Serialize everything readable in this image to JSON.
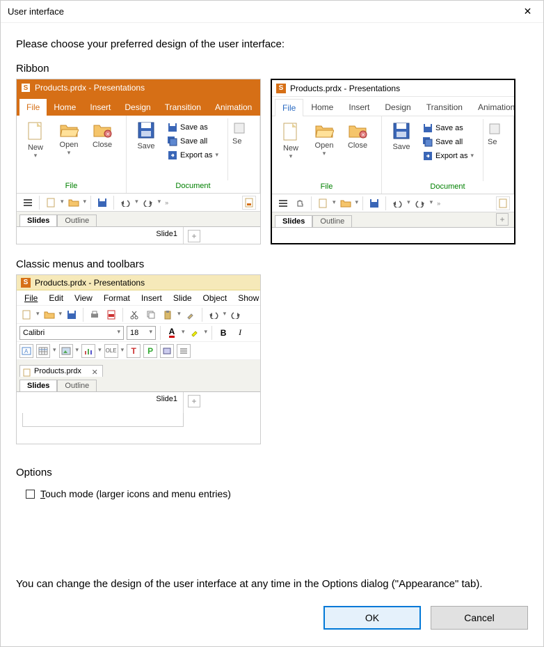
{
  "window": {
    "title": "User interface",
    "close_icon": "✕"
  },
  "intro": "Please choose your preferred design of the user interface:",
  "section_ribbon_label": "Ribbon",
  "section_classic_label": "Classic menus and toolbars",
  "ribbon_preview": {
    "titlebar": "Products.prdx - Presentations",
    "tabs": [
      "File",
      "Home",
      "Insert",
      "Design",
      "Transition",
      "Animation"
    ],
    "file_group": {
      "items": [
        "New",
        "Open",
        "Close"
      ],
      "label": "File"
    },
    "doc_group": {
      "save": "Save",
      "save_as": "Save as",
      "save_all": "Save all",
      "export_as": "Export as",
      "label": "Document",
      "se": "Se"
    },
    "slide_tabs": [
      "Slides",
      "Outline"
    ],
    "slide_name": "Slide1"
  },
  "classic_preview": {
    "titlebar": "Products.prdx - Presentations",
    "menus": [
      "File",
      "Edit",
      "View",
      "Format",
      "Insert",
      "Slide",
      "Object",
      "Show"
    ],
    "font_name": "Calibri",
    "font_size": "18",
    "doc_tab": "Products.prdx",
    "slide_tabs": [
      "Slides",
      "Outline"
    ],
    "slide_name": "Slide1"
  },
  "options": {
    "label": "Options",
    "touch_mode": "Touch mode (larger icons and menu entries)"
  },
  "footer": "You can change the design of the user interface at any time in the Options dialog (\"Appearance\" tab).",
  "buttons": {
    "ok": "OK",
    "cancel": "Cancel"
  }
}
